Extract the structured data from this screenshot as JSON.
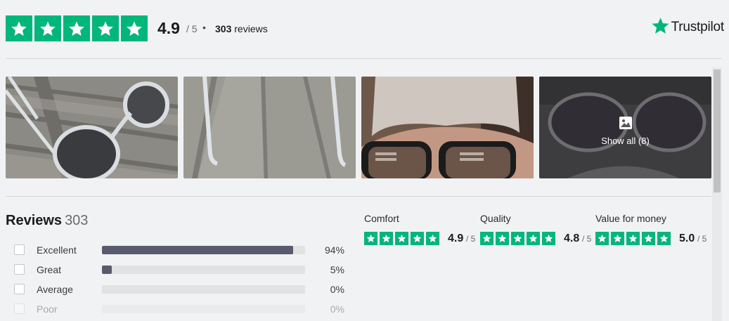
{
  "header": {
    "rating_value": "4.9",
    "rating_max": "/ 5",
    "separator": "•",
    "review_count_bold": "303",
    "review_count_label": "reviews",
    "stars_filled": 5,
    "brand": "Trustpilot",
    "brand_color": "#00b67a"
  },
  "photos": {
    "items": [
      {
        "alt_icon": "photo-sunglasses-table"
      },
      {
        "alt_icon": "photo-sunglasses-arms"
      },
      {
        "alt_icon": "photo-person-wearing-sunglasses"
      },
      {
        "alt_icon": "photo-sunglasses-clear-frame"
      }
    ],
    "show_all_label": "Show all (8)",
    "show_all_icon": "image-icon"
  },
  "reviews": {
    "title": "Reviews",
    "count": "303",
    "distribution": [
      {
        "label": "Excellent",
        "percent": 94,
        "percent_label": "94%"
      },
      {
        "label": "Great",
        "percent": 5,
        "percent_label": "5%"
      },
      {
        "label": "Average",
        "percent": 0,
        "percent_label": "0%"
      },
      {
        "label": "Poor",
        "percent": 0,
        "percent_label": "0%"
      }
    ]
  },
  "categories": [
    {
      "name": "Comfort",
      "score": "4.9",
      "max": "/ 5"
    },
    {
      "name": "Quality",
      "score": "4.8",
      "max": "/ 5"
    },
    {
      "name": "Value for money",
      "score": "5.0",
      "max": "/ 5"
    }
  ]
}
